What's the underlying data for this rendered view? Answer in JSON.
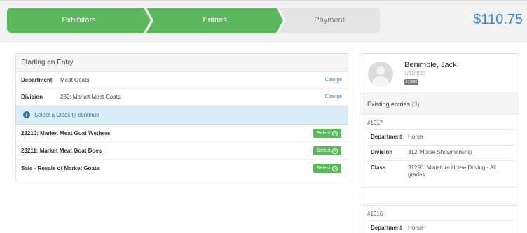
{
  "wizard": {
    "steps": [
      {
        "label": "Exhibitors",
        "state": "complete"
      },
      {
        "label": "Entries",
        "state": "complete"
      },
      {
        "label": "Payment",
        "state": "pending"
      }
    ],
    "total": "$110.75"
  },
  "entry": {
    "heading": "Starting an Entry",
    "department": {
      "key": "Department",
      "value": "Meat Goats",
      "action": "Change"
    },
    "division": {
      "key": "Division",
      "value": "232: Market Meat Goats",
      "action": "Change"
    },
    "alert": "Select a Class to continue",
    "classes": [
      {
        "label": "23210: Market Meat Goat Wethers",
        "action": "Select"
      },
      {
        "label": "23211: Market Meat Goat Does",
        "action": "Select"
      },
      {
        "label": "Sale - Resale of Market Goats",
        "action": "Select"
      }
    ]
  },
  "exhibitor": {
    "name": "Benimble, Jack",
    "date": "1/01/0001",
    "badge": "#73888"
  },
  "existing": {
    "label": "Existing entries",
    "count": "(3)",
    "entries": [
      {
        "id": "#1317",
        "rows": [
          {
            "key": "Department",
            "value": "Horse"
          },
          {
            "key": "Division",
            "value": "312: Horse Showmanship"
          },
          {
            "key": "Class",
            "value": "31250: Miniature Horse Driving - All grades"
          }
        ]
      },
      {
        "id": "#1316",
        "rows": [
          {
            "key": "Department",
            "value": "Horse"
          }
        ]
      }
    ]
  },
  "colors": {
    "step_complete": "#5cb85c",
    "step_pending": "#e4e4e4",
    "total": "#3a87d6",
    "link": "#3a87d6",
    "alert_bg": "#d9edf7",
    "alert_text": "#31708f",
    "select_button": "#5cb85c"
  },
  "icons": {
    "alert": "info-circle-icon",
    "select": "arrow-circle-right-icon",
    "avatar": "user-placeholder-icon"
  }
}
